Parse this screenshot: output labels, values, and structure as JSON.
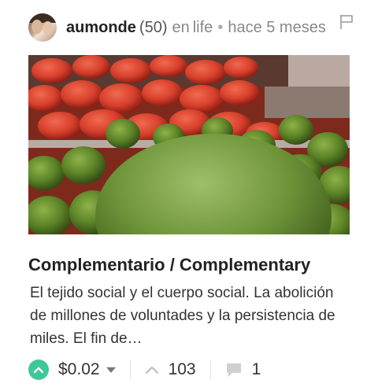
{
  "post": {
    "author": "aumonde",
    "reputation": "(50)",
    "in_label": "en",
    "category": "life",
    "separator": "•",
    "timestamp": "hace 5 meses",
    "title": "Complementario / Complementary",
    "excerpt": "El tejido social y el cuerpo social. La abolición de millones de voluntades y la persistencia de miles. El fin de…",
    "payout": "$0.02",
    "votes": "103",
    "comments": "1"
  },
  "icons": {
    "flag": "flag-icon",
    "upvote": "upvote-icon",
    "caret": "chevron-down-icon",
    "votes": "chevron-up-icon",
    "comments": "comment-icon"
  },
  "colors": {
    "upvote_green": "#3ec89a",
    "muted_text": "#888888"
  }
}
